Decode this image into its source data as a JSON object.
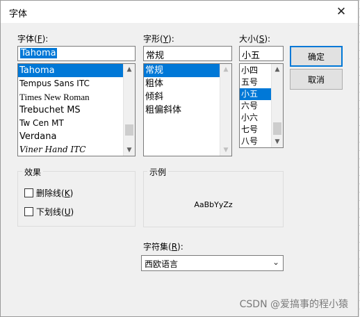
{
  "dialog": {
    "title": "字体",
    "close_glyph": "✕"
  },
  "font": {
    "label": "字体(",
    "accel": "F",
    "label_tail": "):",
    "value": "Tahoma",
    "items": [
      "Tahoma",
      "Tempus Sans ITC",
      "Times New Roman",
      "Trebuchet MS",
      "Tw Cen MT",
      "Verdana",
      "Viner Hand ITC"
    ],
    "selected": "Tahoma"
  },
  "style": {
    "label": "字形(",
    "accel": "Y",
    "label_tail": "):",
    "value": "常规",
    "items": [
      "常规",
      "粗体",
      "倾斜",
      "粗偏斜体"
    ],
    "selected": "常规"
  },
  "size": {
    "label": "大小(",
    "accel": "S",
    "label_tail": "):",
    "value": "小五",
    "items": [
      "小四",
      "五号",
      "小五",
      "六号",
      "小六",
      "七号",
      "八号"
    ],
    "selected": "小五"
  },
  "buttons": {
    "ok": "确定",
    "cancel": "取消"
  },
  "effects": {
    "title": "效果",
    "strikeout_label": "删除线(",
    "strikeout_accel": "K",
    "strikeout_tail": ")",
    "strikeout_checked": false,
    "underline_label": "下划线(",
    "underline_accel": "U",
    "underline_tail": ")",
    "underline_checked": false
  },
  "sample": {
    "title": "示例",
    "text": "AaBbYyZz"
  },
  "charset": {
    "label": "字符集(",
    "accel": "R",
    "label_tail": "):",
    "value": "西欧语言"
  },
  "icons": {
    "scroll_up": "▲",
    "scroll_down": "▼",
    "dropdown": "⌄"
  },
  "watermark": "CSDN @爱搞事的程小猿"
}
